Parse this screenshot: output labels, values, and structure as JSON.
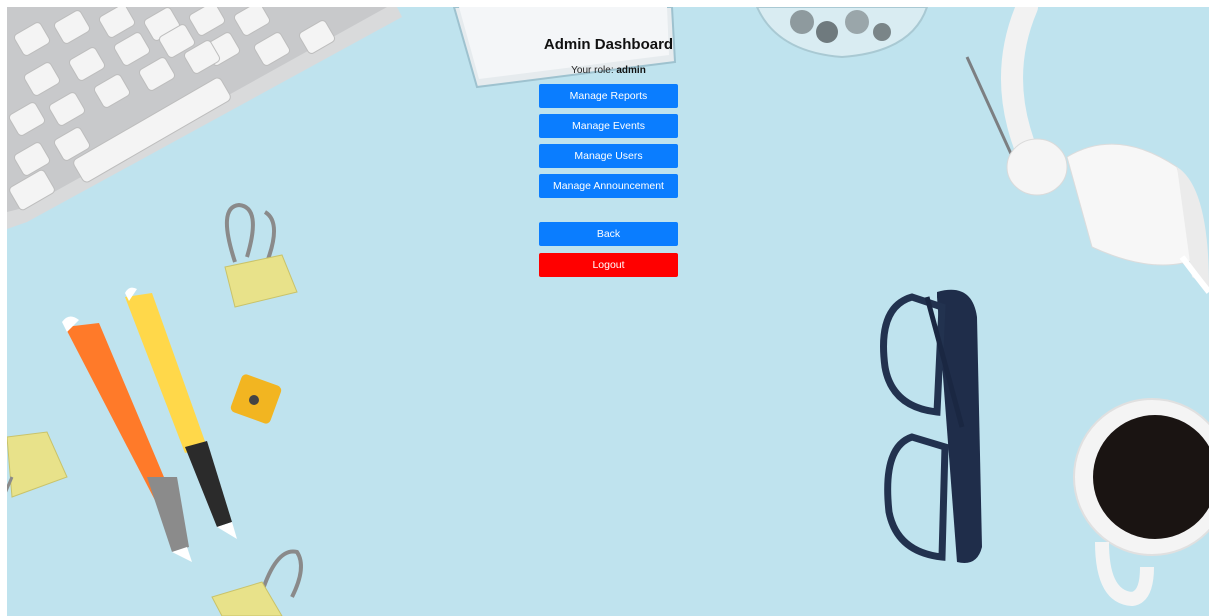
{
  "dashboard": {
    "title": "Admin Dashboard",
    "role_prefix": "Your role:",
    "role_value": "admin"
  },
  "buttons": {
    "manage_reports": "Manage Reports",
    "manage_events": "Manage Events",
    "manage_users": "Manage Users",
    "manage_announcement": "Manage Announcement",
    "back": "Back",
    "logout": "Logout"
  },
  "colors": {
    "primary_button": "#0a7dff",
    "logout_button": "#ff0000",
    "background": "#bfe3ee"
  }
}
